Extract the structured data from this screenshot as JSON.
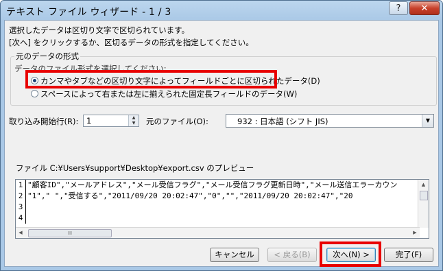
{
  "window": {
    "title": "テキスト ファイル ウィザード - 1 / 3",
    "help": "?",
    "close": "✕"
  },
  "intro": {
    "line1": "選択したデータは区切り文字で区切られています。",
    "line2": "[次へ] をクリックするか、区切るデータの形式を指定してください。"
  },
  "format_group": {
    "title": "元のデータの形式",
    "subtitle": "データのファイル形式を選択してください:",
    "options": [
      {
        "label": "カンマやタブなどの区切り文字によってフィールドごとに区切られたデータ(D)",
        "selected": true
      },
      {
        "label": "スペースによって右または左に揃えられた固定長フィールドのデータ(W)",
        "selected": false
      }
    ]
  },
  "start_row": {
    "label": "取り込み開始行(R):",
    "value": "1"
  },
  "origin": {
    "label": "元のファイル(O):",
    "value": "932 : 日本語 (シフト JIS)"
  },
  "preview": {
    "title": "ファイル C:¥Users¥support¥Desktop¥export.csv のプレビュー",
    "rows": [
      {
        "num": "1",
        "text": "\"顧客ID\",\"メールアドレス\",\"メール受信フラグ\",\"メール受信フラグ更新日時\",\"メール送信エラーカウン"
      },
      {
        "num": "2",
        "text": "\"1\",\"                    \",\"受信する\",\"2011/09/20 20:02:47\",\"0\",\"\",\"2011/09/20 20:02:47\",\"20"
      },
      {
        "num": "3",
        "text": ""
      },
      {
        "num": "4",
        "text": ""
      }
    ],
    "hscroll_grip": "III"
  },
  "buttons": {
    "cancel": "キャンセル",
    "back": "< 戻る(B)",
    "next": "次へ(N) >",
    "finish": "完了(F)"
  },
  "highlight_color": "#e80000"
}
